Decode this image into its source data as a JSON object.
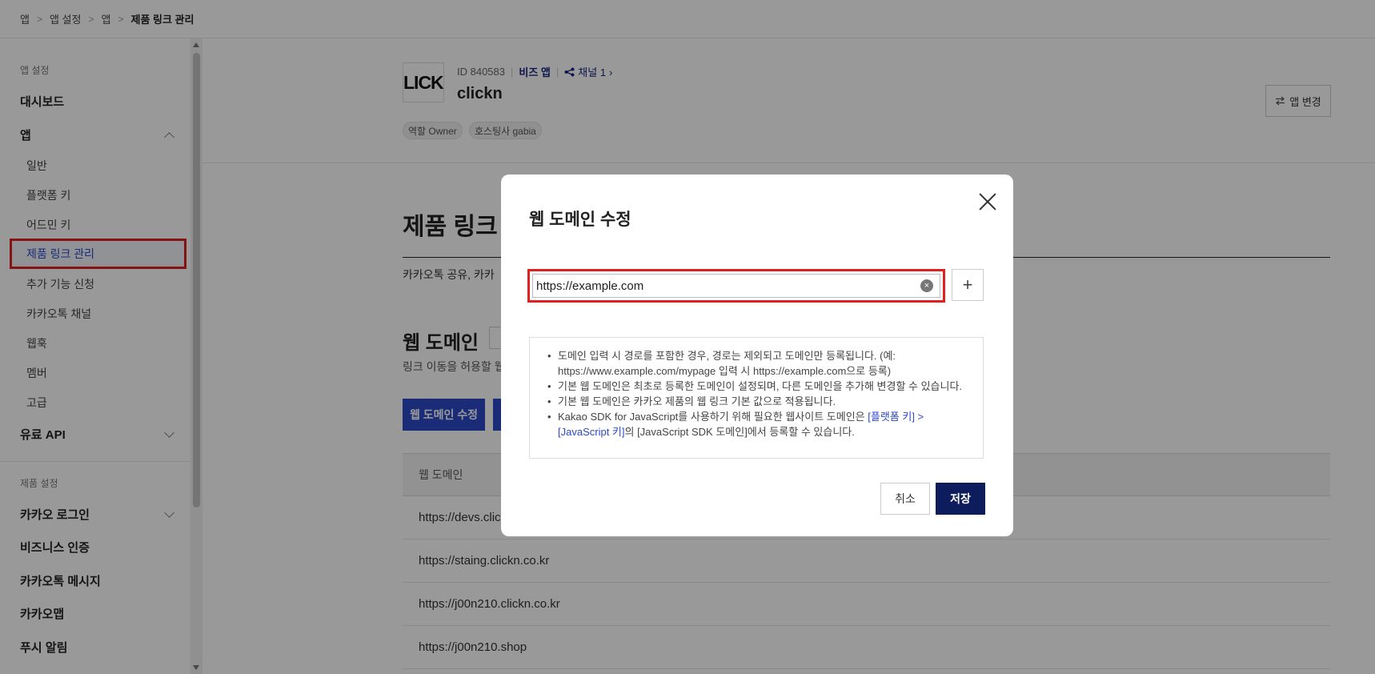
{
  "breadcrumb": [
    "앱",
    "앱 설정",
    "앱",
    "제품 링크 관리"
  ],
  "sidebar": {
    "app_settings_title": "앱 설정",
    "dashboard": "대시보드",
    "app_group": "앱",
    "items": [
      "일반",
      "플랫폼 키",
      "어드민 키",
      "제품 링크 관리",
      "추가 기능 신청",
      "카카오톡 채널",
      "웹훅",
      "멤버",
      "고급"
    ],
    "paid_api": "유료 API",
    "product_settings_title": "제품 설정",
    "product_groups": [
      "카카오 로그인",
      "비즈니스 인증",
      "카카오톡 메시지",
      "카카오맵",
      "푸시 알림"
    ]
  },
  "app": {
    "logo_text": "LICK",
    "id_label": "ID 840583",
    "biz_label": "비즈 앱",
    "channel_label": "채널 1",
    "name": "clickn",
    "tags": [
      "역할 Owner",
      "호스팅사 gabia"
    ],
    "change_button": "앱 변경"
  },
  "main": {
    "page_title": "제품 링크",
    "page_desc": "카카오톡 공유, 카카",
    "section_title": "웹 도메인",
    "section_desc": "링크 이동을 허용할 웹",
    "edit_button": "웹 도메인 수정",
    "table_header": "웹 도메인",
    "rows": [
      "https://devs.clic",
      "https://staing.clickn.co.kr",
      "https://j00n210.clickn.co.kr",
      "https://j00n210.shop"
    ]
  },
  "modal": {
    "title": "웹 도메인 수정",
    "input_value": "https://example.com",
    "add_symbol": "+",
    "clear_symbol": "×",
    "notices": [
      "도메인 입력 시 경로를 포함한 경우, 경로는 제외되고 도메인만 등록됩니다. (예: https://www.example.com/mypage 입력 시 https://example.com으로 등록)",
      "기본 웹 도메인은 최초로 등록한 도메인이 설정되며, 다른 도메인을 추가해 변경할 수 있습니다.",
      "기본 웹 도메인은 카카오 제품의 웹 링크 기본 값으로 적용됩니다."
    ],
    "notice_sdk_before": "Kakao SDK for JavaScript를 사용하기 위해 필요한 웹사이트 도메인은 ",
    "notice_sdk_link": "[플랫폼 키] > [JavaScript 키]",
    "notice_sdk_after": "의 [JavaScript SDK 도메인]에서 등록할 수 있습니다.",
    "cancel_button": "취소",
    "save_button": "저장"
  },
  "colors": {
    "accent": "#2c49c8",
    "save": "#0d1c5c",
    "highlight_border": "#e02020"
  }
}
